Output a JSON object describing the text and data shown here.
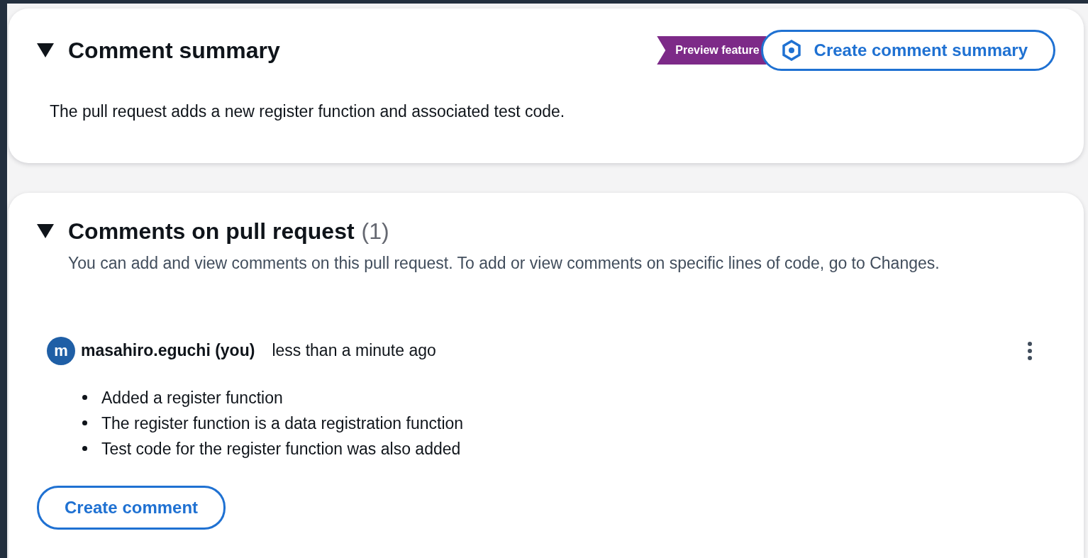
{
  "summary_section": {
    "title": "Comment summary",
    "expanded": true,
    "badge": "Preview feature",
    "button": "Create comment summary",
    "text": "The pull request adds a new register function and associated test code."
  },
  "comments_section": {
    "title": "Comments on pull request",
    "count": "(1)",
    "expanded": true,
    "description": "You can add and view comments on this pull request. To add or view comments on specific lines of code, go to Changes.",
    "comments": [
      {
        "avatar": "m",
        "author": "masahiro.eguchi (you)",
        "time": "less than a minute ago",
        "bullets": [
          "Added a register function",
          "The register function is a data registration function",
          "Test code for the register function was also added"
        ]
      }
    ],
    "button": "Create comment"
  }
}
